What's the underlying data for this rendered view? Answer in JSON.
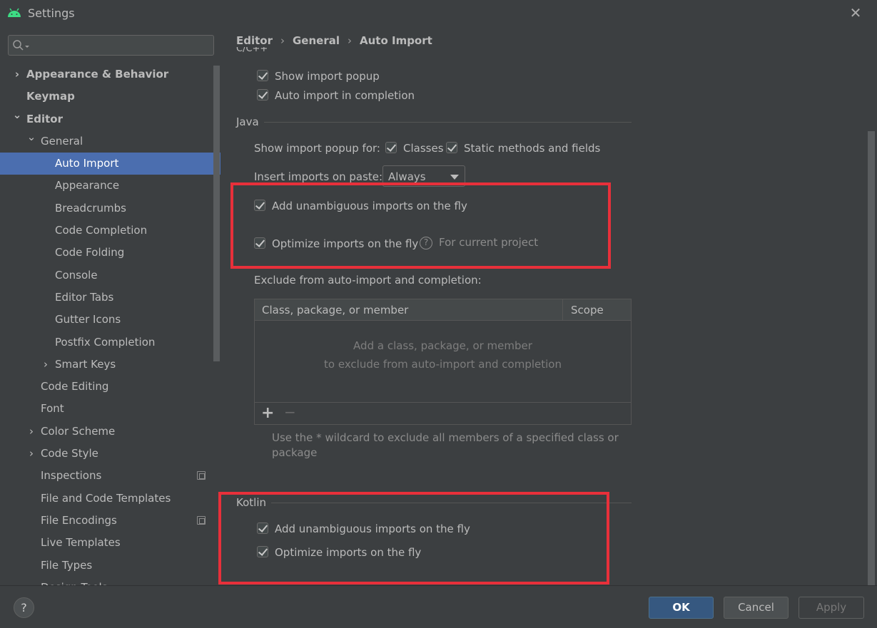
{
  "window": {
    "title": "Settings",
    "close_glyph": "✕"
  },
  "search": {
    "placeholder": ""
  },
  "sidebar": {
    "items": [
      {
        "label": "Appearance & Behavior",
        "level": 0,
        "chevron": "›",
        "bold": true
      },
      {
        "label": "Keymap",
        "level": 0,
        "chevron": "",
        "bold": true
      },
      {
        "label": "Editor",
        "level": 0,
        "chevron": "⌄",
        "bold": true
      },
      {
        "label": "General",
        "level": 1,
        "chevron": "⌄"
      },
      {
        "label": "Auto Import",
        "level": 2,
        "chevron": "",
        "selected": true
      },
      {
        "label": "Appearance",
        "level": 2,
        "chevron": ""
      },
      {
        "label": "Breadcrumbs",
        "level": 2,
        "chevron": ""
      },
      {
        "label": "Code Completion",
        "level": 2,
        "chevron": ""
      },
      {
        "label": "Code Folding",
        "level": 2,
        "chevron": ""
      },
      {
        "label": "Console",
        "level": 2,
        "chevron": ""
      },
      {
        "label": "Editor Tabs",
        "level": 2,
        "chevron": ""
      },
      {
        "label": "Gutter Icons",
        "level": 2,
        "chevron": ""
      },
      {
        "label": "Postfix Completion",
        "level": 2,
        "chevron": ""
      },
      {
        "label": "Smart Keys",
        "level": 2,
        "chevron": "›"
      },
      {
        "label": "Code Editing",
        "level": 1,
        "chevron": ""
      },
      {
        "label": "Font",
        "level": 1,
        "chevron": ""
      },
      {
        "label": "Color Scheme",
        "level": 1,
        "chevron": "›"
      },
      {
        "label": "Code Style",
        "level": 1,
        "chevron": "›"
      },
      {
        "label": "Inspections",
        "level": 1,
        "chevron": "",
        "project_icon": true
      },
      {
        "label": "File and Code Templates",
        "level": 1,
        "chevron": ""
      },
      {
        "label": "File Encodings",
        "level": 1,
        "chevron": "",
        "project_icon": true
      },
      {
        "label": "Live Templates",
        "level": 1,
        "chevron": ""
      },
      {
        "label": "File Types",
        "level": 1,
        "chevron": ""
      },
      {
        "label": "Design Tools",
        "level": 1,
        "chevron": ""
      }
    ]
  },
  "breadcrumb": {
    "part1": "Editor",
    "part2": "General",
    "part3": "Auto Import",
    "sep": "›"
  },
  "cpp": {
    "cut_label": "C/C++",
    "show_import_popup": "Show import popup",
    "auto_import_completion": "Auto import in completion"
  },
  "java": {
    "title": "Java",
    "show_popup_for": "Show import popup for:",
    "classes": "Classes",
    "static_methods": "Static methods and fields",
    "insert_on_paste": "Insert imports on paste:",
    "insert_value": "Always",
    "add_unambiguous": "Add unambiguous imports on the fly",
    "optimize": "Optimize imports on the fly",
    "for_current_project": "For current project",
    "exclude_label": "Exclude from auto-import and completion:",
    "table": {
      "col1": "Class, package, or member",
      "col2": "Scope",
      "empty_line1": "Add a class, package, or member",
      "empty_line2": "to exclude from auto-import and completion"
    },
    "note": "Use the * wildcard to exclude all members of a specified class or package"
  },
  "kotlin": {
    "title": "Kotlin",
    "add_unambiguous": "Add unambiguous imports on the fly",
    "optimize": "Optimize imports on the fly"
  },
  "footer": {
    "help": "?",
    "ok": "OK",
    "cancel": "Cancel",
    "apply": "Apply"
  },
  "colors": {
    "accent_selected": "#4b6eaf",
    "highlight_box": "#e8303a",
    "ok_button": "#365880"
  }
}
